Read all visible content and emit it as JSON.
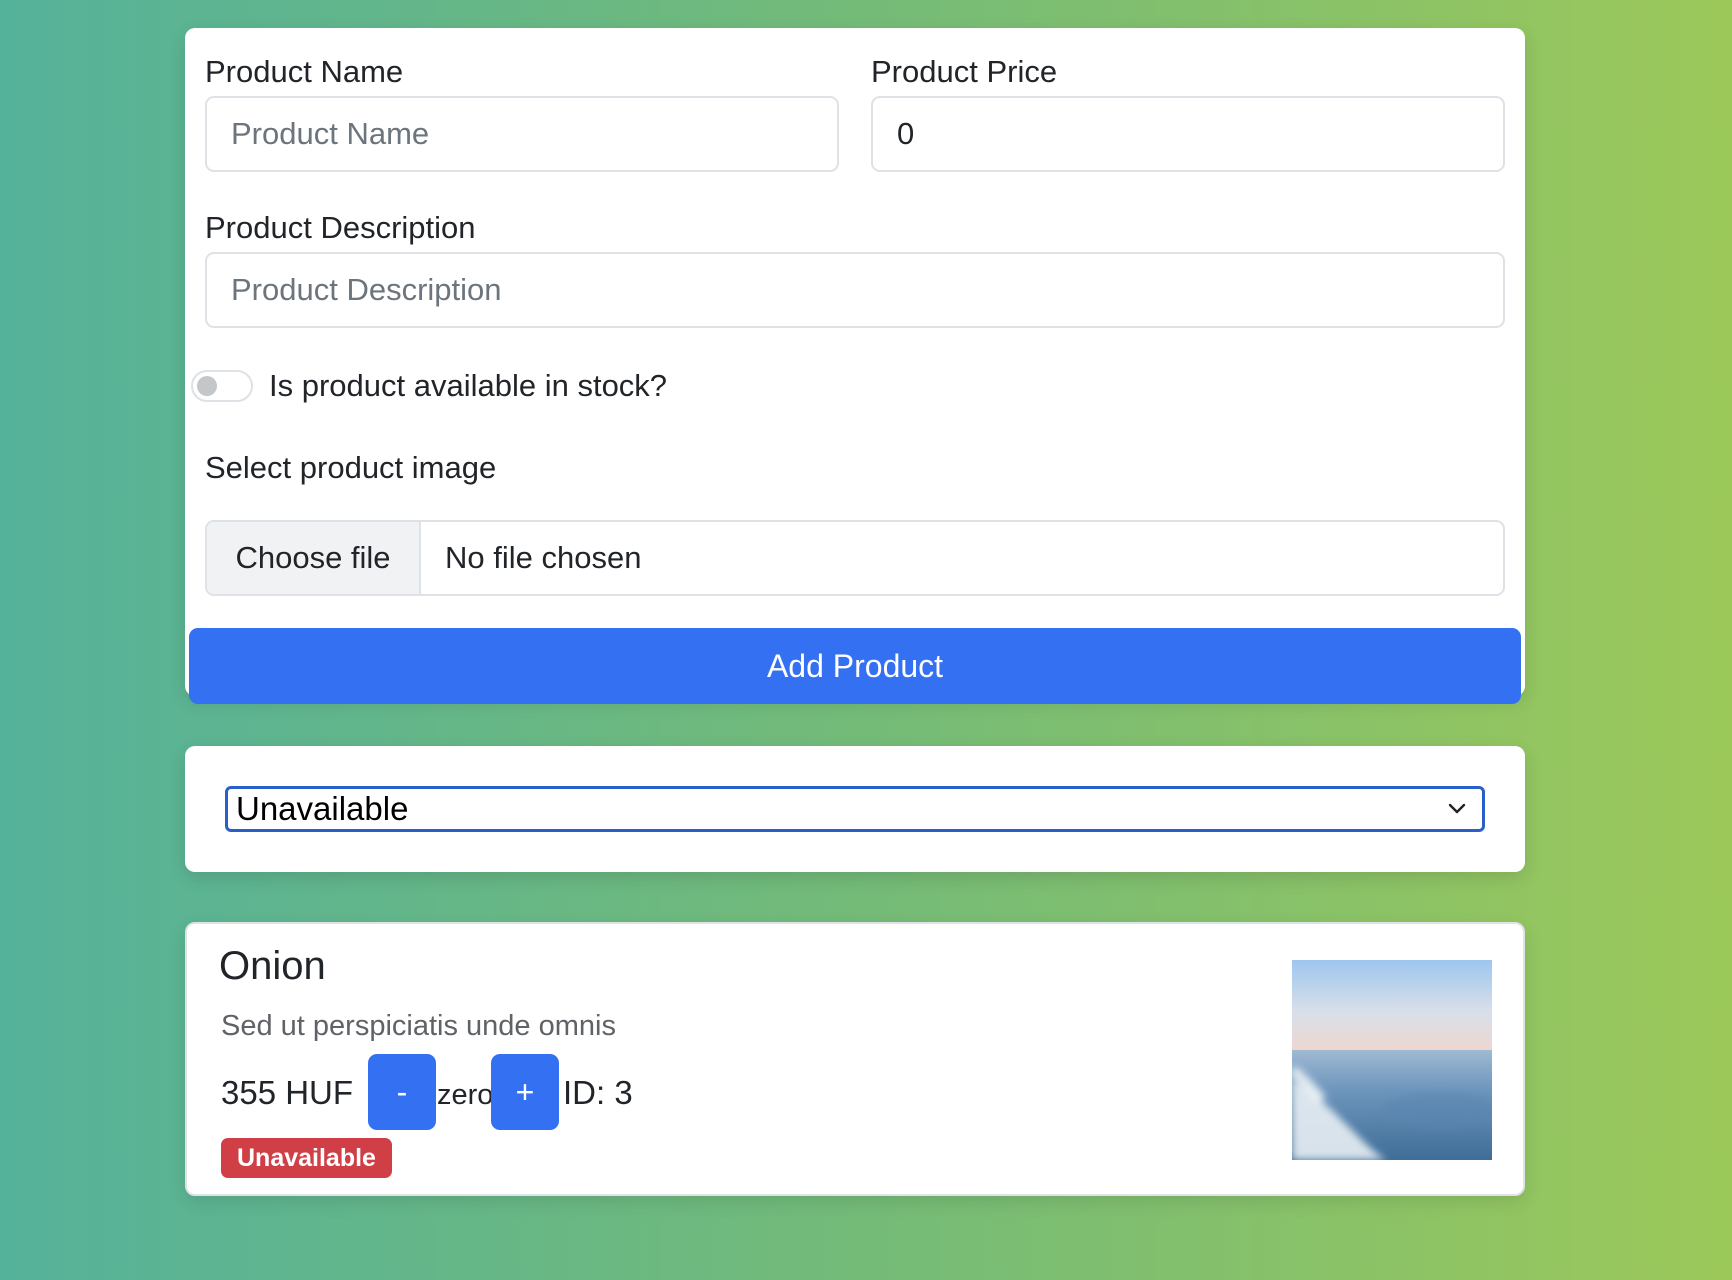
{
  "form": {
    "name_label": "Product Name",
    "name_placeholder": "Product Name",
    "name_value": "",
    "price_label": "Product Price",
    "price_value": "0",
    "description_label": "Product Description",
    "description_placeholder": "Product Description",
    "description_value": "",
    "stock_toggle_label": "Is product available in stock?",
    "stock_toggle_on": false,
    "image_label": "Select product image",
    "choose_file_label": "Choose file",
    "file_status": "No file chosen",
    "submit_label": "Add Product"
  },
  "filter": {
    "selected": "Unavailable"
  },
  "products": [
    {
      "name": "Onion",
      "description": "Sed ut perspiciatis unde omnis",
      "price": "355 HUF",
      "decrement_label": "-",
      "quantity_text": "zero",
      "increment_label": "+",
      "id_text": "ID: 3",
      "status_badge": "Unavailable"
    }
  ],
  "colors": {
    "primary": "#3371f2",
    "danger": "#d03f46",
    "select_border": "#2a5fc9"
  },
  "icons": {
    "select_arrow": "chevron-down-icon",
    "product_image": "sea-photo-image"
  }
}
